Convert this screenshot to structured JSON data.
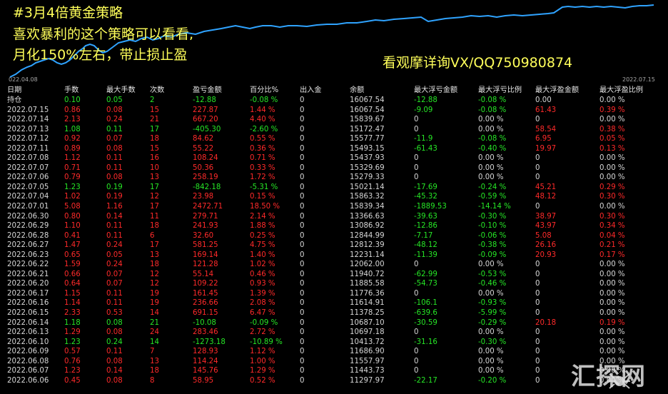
{
  "overlay": {
    "line1": "#3月4倍黄金策略",
    "line2": "喜欢暴利的这个策略可以看看,",
    "line3": "月化150%左右，带止损止盈",
    "contact": "看观摩详询VX/QQ750980874"
  },
  "chart": {
    "start_date": "022.04.08",
    "end_date": "2022.07.15",
    "line_color": "#2fa3ff"
  },
  "table": {
    "headers": [
      "日期",
      "手数",
      "最大手数",
      "次数",
      "盈亏金额",
      "百分比%",
      "出入金",
      "余额",
      "最大浮亏金额",
      "最大浮亏比例",
      "最大浮盈金额",
      "最大浮盈比例"
    ],
    "rows": [
      [
        "持仓",
        "0.10",
        "0.05",
        "2",
        "-12.88",
        "-0.08 %",
        "0",
        "16067.54",
        "-12.88",
        "-0.08 %",
        "0.00",
        "0.00 %"
      ],
      [
        "2022.07.15",
        "0.86",
        "0.08",
        "15",
        "227.87",
        "1.44 %",
        "0",
        "16067.54",
        "-9.09",
        "-0.08 %",
        "61.43",
        "0.39 %"
      ],
      [
        "2022.07.14",
        "2.13",
        "0.24",
        "21",
        "667.20",
        "4.40 %",
        "0",
        "15839.67",
        "0",
        "0.00 %",
        "0",
        "0.00 %"
      ],
      [
        "2022.07.13",
        "1.08",
        "0.11",
        "17",
        "-405.30",
        "-2.60 %",
        "0",
        "15172.47",
        "0",
        "0.00 %",
        "58.54",
        "0.38 %"
      ],
      [
        "2022.07.12",
        "0.92",
        "0.07",
        "18",
        "84.62",
        "0.55 %",
        "0",
        "15577.77",
        "-11.9",
        "-0.08 %",
        "6.95",
        "0.05 %"
      ],
      [
        "2022.07.11",
        "0.89",
        "0.08",
        "15",
        "55.22",
        "0.36 %",
        "0",
        "15493.15",
        "-61.43",
        "-0.40 %",
        "19.97",
        "0.13 %"
      ],
      [
        "2022.07.08",
        "1.12",
        "0.11",
        "16",
        "108.24",
        "0.71 %",
        "0",
        "15437.93",
        "0",
        "0.00 %",
        "0",
        "0.00 %"
      ],
      [
        "2022.07.07",
        "0.71",
        "0.11",
        "10",
        "50.36",
        "0.33 %",
        "0",
        "15329.69",
        "0",
        "0.00 %",
        "0",
        "0.00 %"
      ],
      [
        "2022.07.06",
        "0.79",
        "0.08",
        "13",
        "258.19",
        "1.72 %",
        "0",
        "15279.33",
        "0",
        "0.00 %",
        "0",
        "0.00 %"
      ],
      [
        "2022.07.05",
        "1.23",
        "0.19",
        "17",
        "-842.18",
        "-5.31 %",
        "0",
        "15021.14",
        "-17.69",
        "-0.24 %",
        "45.21",
        "0.29 %"
      ],
      [
        "2022.07.04",
        "1.02",
        "0.19",
        "12",
        "23.98",
        "0.15 %",
        "0",
        "15863.32",
        "-45.32",
        "-0.59 %",
        "48.12",
        "0.30 %"
      ],
      [
        "2022.07.01",
        "5.08",
        "1.16",
        "17",
        "2472.71",
        "18.50 %",
        "0",
        "15839.34",
        "-1889.53",
        "-14.14 %",
        "0",
        "0.00 %"
      ],
      [
        "2022.06.30",
        "0.80",
        "0.14",
        "11",
        "279.71",
        "2.14 %",
        "0",
        "13366.63",
        "-39.63",
        "-0.30 %",
        "38.97",
        "0.30 %"
      ],
      [
        "2022.06.29",
        "1.10",
        "0.11",
        "18",
        "241.93",
        "1.88 %",
        "0",
        "13086.92",
        "-12.86",
        "-0.10 %",
        "43.97",
        "0.34 %"
      ],
      [
        "2022.06.28",
        "0.41",
        "0.11",
        "6",
        "32.60",
        "0.25 %",
        "0",
        "12844.99",
        "-7.17",
        "-0.06 %",
        "5.08",
        "0.04 %"
      ],
      [
        "2022.06.27",
        "1.47",
        "0.24",
        "17",
        "581.25",
        "4.75 %",
        "0",
        "12812.39",
        "-48.12",
        "-0.38 %",
        "26.16",
        "0.21 %"
      ],
      [
        "2022.06.23",
        "0.65",
        "0.05",
        "13",
        "169.14",
        "1.40 %",
        "0",
        "12231.14",
        "-11.39",
        "-0.09 %",
        "20.93",
        "0.17 %"
      ],
      [
        "2022.06.22",
        "1.59",
        "0.24",
        "18",
        "121.28",
        "1.02 %",
        "0",
        "12062.00",
        "0",
        "0.00 %",
        "0",
        "0.00 %"
      ],
      [
        "2022.06.21",
        "0.66",
        "0.07",
        "12",
        "55.14",
        "0.46 %",
        "0",
        "11940.72",
        "-62.99",
        "-0.53 %",
        "0",
        "0.00 %"
      ],
      [
        "2022.06.20",
        "0.64",
        "0.07",
        "12",
        "109.22",
        "0.93 %",
        "0",
        "11885.58",
        "-54.73",
        "-0.46 %",
        "0",
        "0.00 %"
      ],
      [
        "2022.06.17",
        "1.15",
        "0.11",
        "19",
        "161.45",
        "1.39 %",
        "0",
        "11776.36",
        "0",
        "0.00 %",
        "0",
        "0.00 %"
      ],
      [
        "2022.06.16",
        "1.14",
        "0.11",
        "19",
        "236.66",
        "2.08 %",
        "0",
        "11614.91",
        "-106.1",
        "-0.93 %",
        "0",
        "0.00 %"
      ],
      [
        "2022.06.15",
        "2.33",
        "0.53",
        "14",
        "691.15",
        "6.47 %",
        "0",
        "11378.25",
        "-639.6",
        "-5.99 %",
        "0",
        "0.00 %"
      ],
      [
        "2022.06.14",
        "1.18",
        "0.08",
        "21",
        "-10.08",
        "-0.09 %",
        "0",
        "10687.10",
        "-30.59",
        "-0.29 %",
        "20.18",
        "0.19 %"
      ],
      [
        "2022.06.13",
        "1.29",
        "0.08",
        "24",
        "283.46",
        "2.72 %",
        "0",
        "10697.18",
        "0",
        "0.00 %",
        "0",
        "0.00 %"
      ],
      [
        "2022.06.10",
        "1.23",
        "0.24",
        "14",
        "-1273.18",
        "-10.89 %",
        "0",
        "10413.72",
        "-31.16",
        "-0.30 %",
        "0",
        "0.00 %"
      ],
      [
        "2022.06.09",
        "0.57",
        "0.11",
        "7",
        "128.93",
        "1.12 %",
        "0",
        "11686.90",
        "0",
        "0.00 %",
        "0",
        "0.00 %"
      ],
      [
        "2022.06.08",
        "0.76",
        "0.08",
        "13",
        "114.24",
        "1.00 %",
        "0",
        "11557.97",
        "0",
        "0.00 %",
        "0",
        "0.00 %"
      ],
      [
        "2022.06.07",
        "1.23",
        "0.14",
        "18",
        "145.76",
        "1.29 %",
        "0",
        "11443.73",
        "0",
        "0.00 %",
        "0",
        "0.00 %"
      ],
      [
        "2022.06.06",
        "0.45",
        "0.08",
        "8",
        "58.95",
        "0.52 %",
        "0",
        "11297.97",
        "-22.17",
        "-0.20 %",
        "0",
        "0.00 %"
      ]
    ]
  },
  "watermark": {
    "text": "汇探网",
    "logo_icon": "spider-icon"
  },
  "colors": {
    "positive": "#ff2a2a",
    "negative": "#26e626",
    "neutral": "#d7d7d7",
    "overlay_text": "#ffff5a",
    "background": "#000000"
  }
}
